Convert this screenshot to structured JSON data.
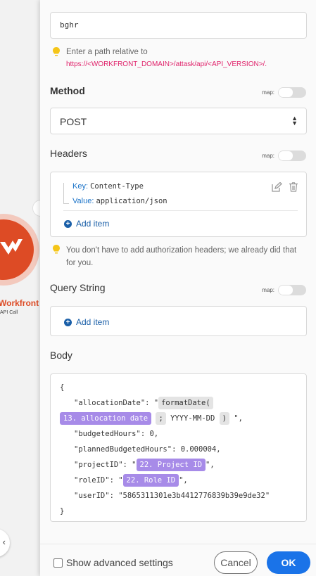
{
  "canvas": {
    "module_name": "Workfront",
    "module_sub": "API Call"
  },
  "url": {
    "value": "bghr",
    "hint": "Enter a path relative to",
    "hint_link": "https://<WORKFRONT_DOMAIN>/attask/api/<API_VERSION>/."
  },
  "method": {
    "label": "Method",
    "map_label": "map:",
    "value": "POST"
  },
  "headers": {
    "label": "Headers",
    "map_label": "map:",
    "items": [
      {
        "key_label": "Key:",
        "key": "Content-Type",
        "value_label": "Value:",
        "value": "application/json"
      }
    ],
    "add_item": "Add item",
    "hint": "You don't have to add authorization headers; we already did that for you."
  },
  "query_string": {
    "label": "Query String",
    "map_label": "map:",
    "add_item": "Add item"
  },
  "body": {
    "label": "Body",
    "open_brace": "{",
    "close_brace": "}",
    "alloc_key": "\"allocationDate\": \"",
    "format_date": "formatDate(",
    "alloc_chip": "13. allocation date",
    "semicolon": ";",
    "date_format": "YYYY-MM-DD",
    "paren_close": ")",
    "alloc_end": "\",",
    "budgeted": "\"budgetedHours\": 0,",
    "planned": "\"plannedBudgetedHours\": 0.000004,",
    "project_key": "\"projectID\": \"",
    "project_chip": "22. Project ID",
    "project_end": "\",",
    "role_key": "\"roleID\": \"",
    "role_chip": "22. Role ID",
    "role_end": "\",",
    "user": "\"userID\": \"5865311301e3b4412776839b39e9de32\""
  },
  "footer": {
    "advanced": "Show advanced settings",
    "cancel": "Cancel",
    "ok": "OK"
  },
  "colors": {
    "primary": "#1a73e8",
    "link": "#1a5fa8",
    "workfront": "#dd4b25",
    "chip": "#a78be8"
  }
}
